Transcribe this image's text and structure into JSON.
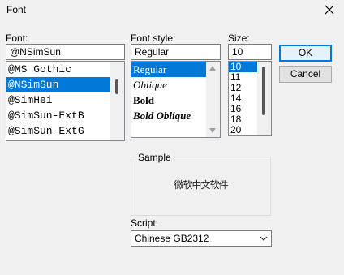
{
  "window": {
    "title": "Font",
    "close_icon": "close-icon"
  },
  "font": {
    "label": "Font:",
    "value": "@NSimSun",
    "items": [
      "@MS Gothic",
      "@NSimSun",
      "@SimHei",
      "@SimSun-ExtB",
      "@SimSun-ExtG"
    ],
    "selected_index": 1
  },
  "style": {
    "label": "Font style:",
    "value": "Regular",
    "items": [
      "Regular",
      "Oblique",
      "Bold",
      "Bold Oblique"
    ],
    "selected_index": 0
  },
  "size": {
    "label": "Size:",
    "value": "10",
    "items": [
      "10",
      "11",
      "12",
      "14",
      "16",
      "18",
      "20"
    ],
    "selected_index": 0
  },
  "buttons": {
    "ok": "OK",
    "cancel": "Cancel"
  },
  "sample": {
    "label": "Sample",
    "text": "微软中文软件"
  },
  "script": {
    "label": "Script:",
    "value": "Chinese GB2312"
  },
  "colors": {
    "accent": "#0078d7",
    "background": "#f0f0f0"
  }
}
